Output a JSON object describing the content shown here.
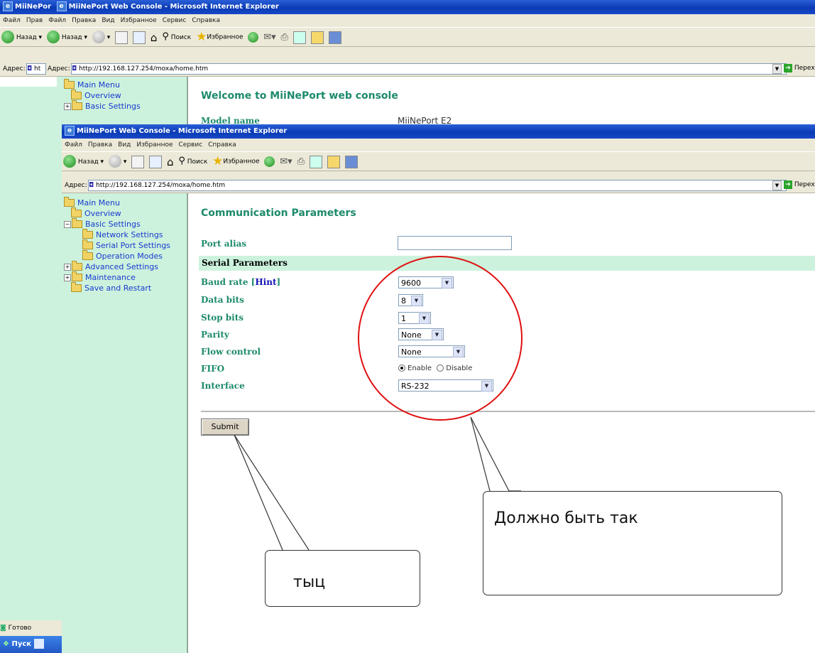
{
  "back_window": {
    "tab_title_fragment": "MiiNePor",
    "title": "MiiNePort Web Console - Microsoft Internet Explorer",
    "menu": [
      "Файл",
      "Прав",
      "Файл",
      "Правка",
      "Вид",
      "Избранное",
      "Сервис",
      "Справка"
    ],
    "toolbar": {
      "back": "Назад",
      "back_fragment": "Назад",
      "search": "Поиск",
      "favorites": "Избранное"
    },
    "address_label": "Адрес:",
    "address_label_fragment": "Адрес:",
    "address_fragment": "ht",
    "address": "http://192.168.127.254/moxa/home.htm",
    "go": "Переход",
    "sidebar": [
      {
        "label": "Main Menu"
      },
      {
        "label": "Overview"
      },
      {
        "label": "Basic Settings"
      }
    ],
    "welcome": "Welcome to MiiNePort web console",
    "model_label": "Model name",
    "model_value": "MiiNePort E2",
    "status": "Готово"
  },
  "front_window": {
    "title": "MiiNePort Web Console - Microsoft Internet Explorer",
    "menu": [
      "Файл",
      "Правка",
      "Вид",
      "Избранное",
      "Сервис",
      "Справка"
    ],
    "toolbar": {
      "back": "Назад",
      "search": "Поиск",
      "favorites": "Избранное"
    },
    "address_label": "Адрес:",
    "address": "http://192.168.127.254/moxa/home.htm",
    "go": "Переход",
    "sidebar": {
      "main_menu": "Main Menu",
      "overview": "Overview",
      "basic_settings": "Basic Settings",
      "network_settings": "Network Settings",
      "serial_port_settings": "Serial Port Settings",
      "operation_modes": "Operation Modes",
      "advanced_settings": "Advanced Settings",
      "maintenance": "Maintenance",
      "save_restart": "Save and Restart"
    },
    "page_title": "Communication Parameters",
    "port_alias_label": "Port alias",
    "port_alias_value": "",
    "serial_header": "Serial Parameters",
    "baud_label": "Baud rate [",
    "baud_hint": "Hint",
    "baud_label_end": "]",
    "baud_value": "9600",
    "data_bits_label": "Data bits",
    "data_bits_value": "8",
    "stop_bits_label": "Stop bits",
    "stop_bits_value": "1",
    "parity_label": "Parity",
    "parity_value": "None",
    "flow_label": "Flow control",
    "flow_value": "None",
    "fifo_label": "FIFO",
    "fifo_enable": "Enable",
    "fifo_disable": "Disable",
    "fifo_selected": "Enable",
    "interface_label": "Interface",
    "interface_value": "RS-232",
    "submit": "Submit"
  },
  "annotations": {
    "callout_right": "Должно быть так",
    "callout_left": "тыц",
    "circle_color": "#e01010"
  },
  "taskbar": {
    "start": "Пуск"
  },
  "colors": {
    "sidebar_bg": "#ccf2dd",
    "title_green": "#1d8a6b",
    "link_blue": "#1a3ad0"
  }
}
